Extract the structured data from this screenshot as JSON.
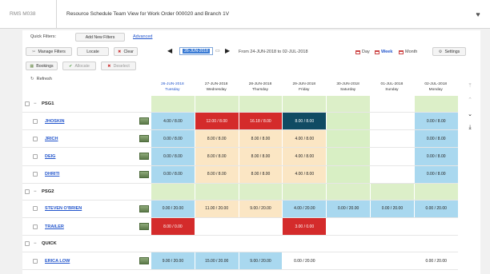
{
  "window": {
    "code": "RMS M038",
    "title": "Resource Schedule Team View for Work Order 000020 and Branch 1V"
  },
  "toolbar": {
    "quick_filters_label": "Quick Filters:",
    "add_filters_label": "Add New Filters",
    "advanced_label": "Advanced",
    "manage_filters_label": "Manage Filters",
    "locate_label": "Locate",
    "clear_label": "Clear",
    "bookings_label": "Bookings",
    "allocate_label": "Allocate",
    "deselect_label": "Deselect",
    "refresh_label": "Refresh"
  },
  "date_nav": {
    "selected_date": "26-JUN-2018",
    "from_label": "From",
    "from_date": "24-JUN-2018",
    "to_label": "to",
    "to_date": "02-JUL-2018"
  },
  "views": {
    "day": "Day",
    "week": "Week",
    "month": "Month",
    "settings": "Settings",
    "active": "Week"
  },
  "columns": [
    {
      "date": "26-JUN-2018",
      "day": "Tuesday",
      "today": true
    },
    {
      "date": "27-JUN-2018",
      "day": "Wednesday",
      "today": false
    },
    {
      "date": "28-JUN-2018",
      "day": "Thursday",
      "today": false
    },
    {
      "date": "29-JUN-2018",
      "day": "Friday",
      "today": false
    },
    {
      "date": "30-JUN-2018",
      "day": "Saturday",
      "today": false
    },
    {
      "date": "01-JUL-2018",
      "day": "Sunday",
      "today": false
    },
    {
      "date": "02-JUL-2018",
      "day": "Monday",
      "today": false
    }
  ],
  "colors": {
    "blue": "#a9d8ef",
    "red": "#d42b2b",
    "tan": "#fbe6c4",
    "navy": "#104b63",
    "green": "#d8efc4",
    "white": "#ffffff",
    "group_green": "#dcefc8",
    "group_tan": "#f3e4c8",
    "group_blue": "#d6ecf6"
  },
  "rows": [
    {
      "type": "group",
      "name": "PSG1",
      "fills": [
        "green",
        "green",
        "green",
        "green",
        "green",
        "white",
        "green"
      ]
    },
    {
      "type": "res",
      "name": "JHOSKIN",
      "cells": [
        [
          "4.00 / 8.00",
          "blue"
        ],
        [
          "12.00 / 8.00",
          "red"
        ],
        [
          "16.18 / 8.00",
          "red"
        ],
        [
          "8.00 / 8.00",
          "navy"
        ],
        [
          "",
          "green"
        ],
        [
          "",
          "white"
        ],
        [
          "0.00 / 8.00",
          "blue"
        ]
      ]
    },
    {
      "type": "res",
      "name": "JRICH",
      "cells": [
        [
          "0.00 / 8.00",
          "blue"
        ],
        [
          "8.00 / 8.00",
          "tan"
        ],
        [
          "8.00 / 8.00",
          "tan"
        ],
        [
          "4.00 / 8.00",
          "tan"
        ],
        [
          "",
          "green"
        ],
        [
          "",
          "white"
        ],
        [
          "0.00 / 8.00",
          "blue"
        ]
      ]
    },
    {
      "type": "res",
      "name": "DEIG",
      "cells": [
        [
          "0.00 / 8.00",
          "blue"
        ],
        [
          "8.00 / 8.00",
          "tan"
        ],
        [
          "8.00 / 8.00",
          "tan"
        ],
        [
          "4.00 / 8.00",
          "tan"
        ],
        [
          "",
          "green"
        ],
        [
          "",
          "white"
        ],
        [
          "0.00 / 8.00",
          "blue"
        ]
      ]
    },
    {
      "type": "res",
      "name": "DHRITI",
      "cells": [
        [
          "0.00 / 8.00",
          "blue"
        ],
        [
          "8.00 / 8.00",
          "tan"
        ],
        [
          "8.00 / 8.00",
          "tan"
        ],
        [
          "4.00 / 8.00",
          "tan"
        ],
        [
          "",
          "green"
        ],
        [
          "",
          "white"
        ],
        [
          "0.00 / 8.00",
          "blue"
        ]
      ]
    },
    {
      "type": "group",
      "name": "PSG2",
      "fills": [
        "green",
        "green",
        "green",
        "green",
        "green",
        "green",
        "green"
      ]
    },
    {
      "type": "res",
      "name": "STEVEN O'BRIEN",
      "cells": [
        [
          "0.00 / 20.00",
          "blue"
        ],
        [
          "11.00 / 20.00",
          "tan"
        ],
        [
          "9.00 / 20.00",
          "tan"
        ],
        [
          "4.00 / 20.00",
          "blue"
        ],
        [
          "0.00 / 20.00",
          "blue"
        ],
        [
          "0.00 / 20.00",
          "blue"
        ],
        [
          "0.00 / 20.00",
          "blue"
        ]
      ]
    },
    {
      "type": "res",
      "name": "TRAILER",
      "cells": [
        [
          "8.00 / 0.00",
          "red"
        ],
        [
          "",
          "white"
        ],
        [
          "",
          "white"
        ],
        [
          "3.00 / 0.00",
          "red"
        ],
        [
          "",
          "white"
        ],
        [
          "",
          "white"
        ],
        [
          "",
          "white"
        ]
      ]
    },
    {
      "type": "group",
      "name": "QUICK",
      "fills": [
        "white",
        "white",
        "white",
        "white",
        "white",
        "white",
        "white"
      ]
    },
    {
      "type": "res",
      "name": "ERICA LOW",
      "cells": [
        [
          "9.00 / 20.00",
          "blue"
        ],
        [
          "15.00 / 20.00",
          "blue"
        ],
        [
          "9.00 / 20.00",
          "blue"
        ],
        [
          "0.00 / 20.00",
          "white"
        ],
        [
          "",
          "white"
        ],
        [
          "",
          "white"
        ],
        [
          "0.00 / 20.00",
          "white"
        ]
      ]
    }
  ]
}
